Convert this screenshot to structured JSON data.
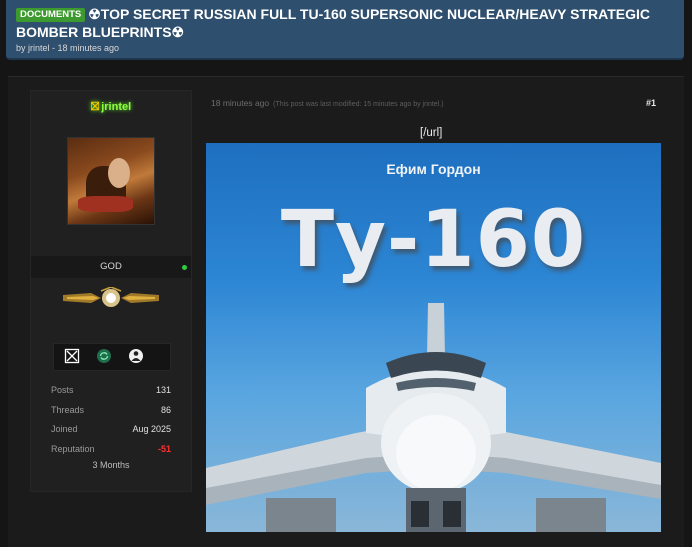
{
  "thread": {
    "prefix": "DOCUMENTS",
    "title": "☢TOP SECRET RUSSIAN FULL TU-160 SUPERSONIC NUCLEAR/HEAVY STRATEGIC BOMBER BLUEPRINTS☢",
    "byline": "by jrintel - 18 minutes ago"
  },
  "user": {
    "name_tag": "⛝",
    "name": "jrintel",
    "rank": "GOD",
    "online": true,
    "badges": [
      "hourglass-icon",
      "refresh-badge-icon",
      "anonymous-mask-icon"
    ],
    "stats": [
      {
        "label": "Posts",
        "value": "131"
      },
      {
        "label": "Threads",
        "value": "86"
      },
      {
        "label": "Joined",
        "value": "Aug 2025"
      },
      {
        "label": "Reputation",
        "value": "-51"
      }
    ],
    "membership": "3 Months"
  },
  "post": {
    "time": "18 minutes ago",
    "modified": "(This post was last modified: 15 minutes ago by jrintel.)",
    "number": "#1",
    "url_text": "[/url]",
    "cover_author": "Ефим Гордон",
    "cover_title": "Ту-160"
  },
  "colors": {
    "header_bg": "#2f4f6e",
    "prefix_badge": "#3d9a2e",
    "username": "#8cff3f",
    "negative_rep": "#ff3030",
    "online": "#2ecc40"
  }
}
